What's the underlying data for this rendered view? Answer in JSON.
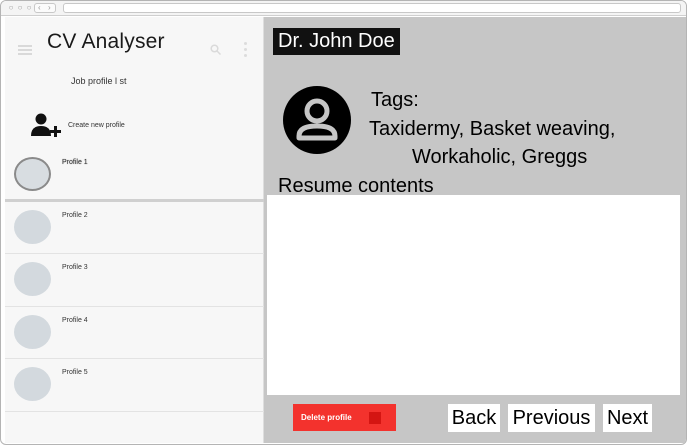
{
  "app": {
    "title": "CV Analyser"
  },
  "sidebar": {
    "list_heading": "Job profile l st",
    "create_label": "Create new profile",
    "profiles": [
      {
        "label": "Profile 1",
        "selected": true
      },
      {
        "label": "Profile 2",
        "selected": false
      },
      {
        "label": "Profile 3",
        "selected": false
      },
      {
        "label": "Profile 4",
        "selected": false
      },
      {
        "label": "Profile 5",
        "selected": false
      }
    ]
  },
  "detail": {
    "name": "Dr. John Doe",
    "tags_label": "Tags:",
    "tags_line1": "Taxidermy, Basket weaving,",
    "tags_line2": "Workaholic, Greggs",
    "resume_label": "Resume contents",
    "resume_text": ""
  },
  "actions": {
    "delete_label": "Delete profile",
    "back_label": "Back",
    "previous_label": "Previous",
    "next_label": "Next"
  },
  "colors": {
    "delete": "#f3322d",
    "detail_bg": "#c6c6c6",
    "sidebar_bg": "#f7f7f7"
  }
}
